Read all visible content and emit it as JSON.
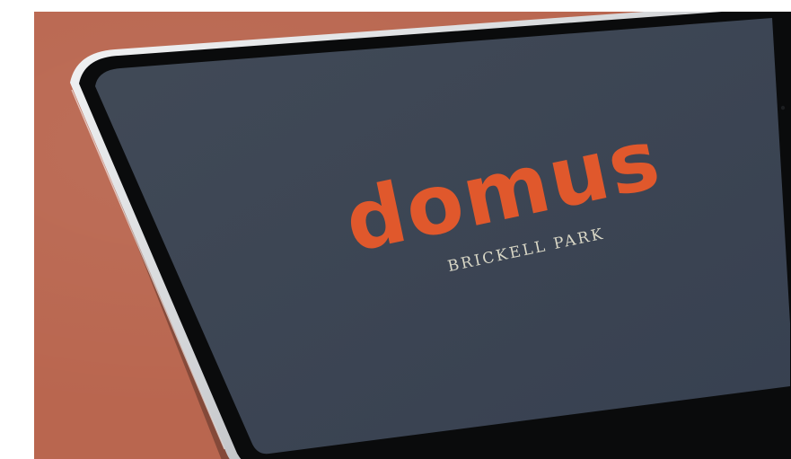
{
  "brand": {
    "logo_text": "domus",
    "tagline": "BRICKELL PARK"
  },
  "colors": {
    "backdrop": "#b9664f",
    "tablet_frame": "#e7e8ea",
    "tablet_bezel": "#0a0b0c",
    "screen": "#3c4552",
    "logo_orange": "#e0582c",
    "tagline_cream": "#d9d7c6"
  },
  "icons": {
    "device": "tablet-device"
  }
}
